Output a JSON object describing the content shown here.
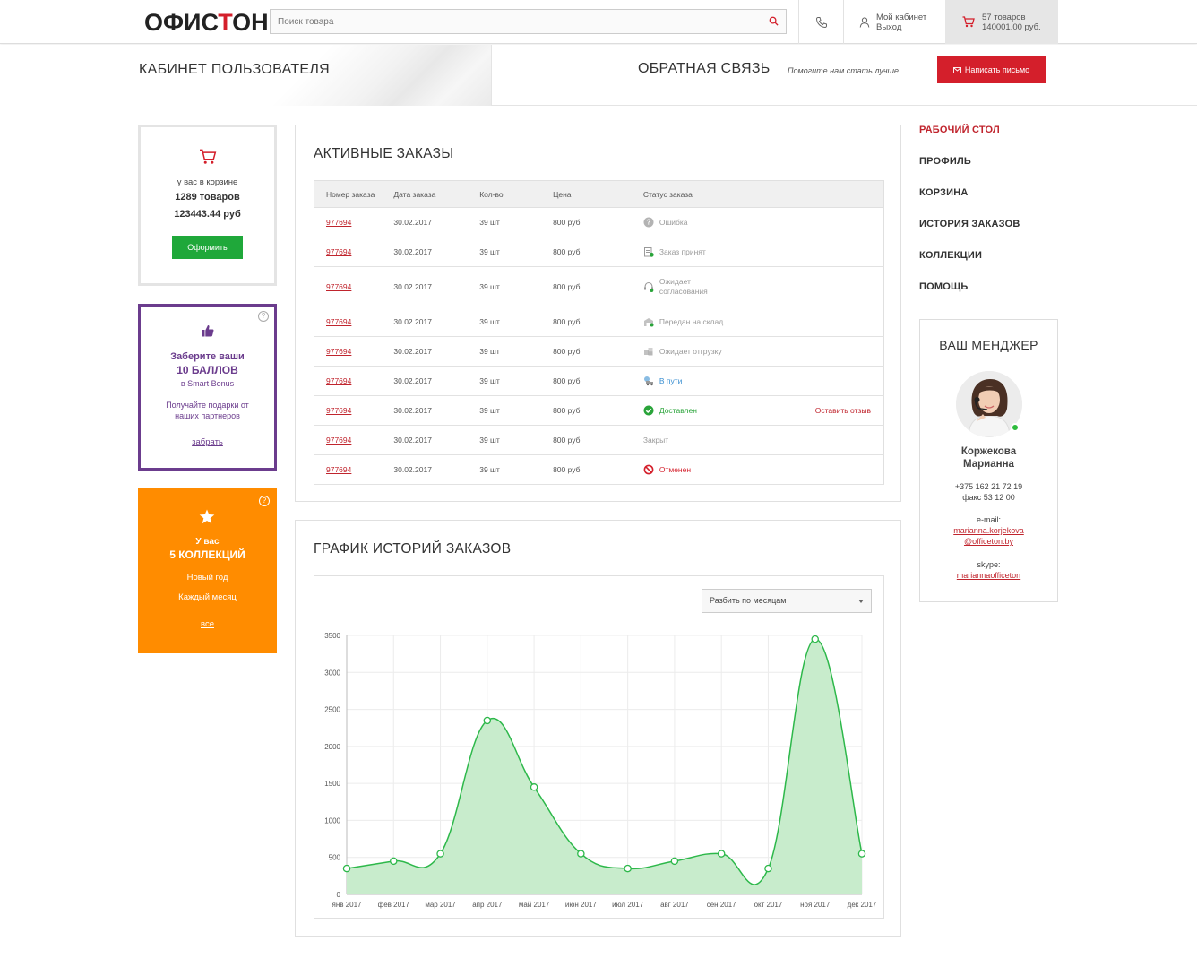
{
  "header": {
    "logo": {
      "part1": "ОФИС",
      "part2": "Т",
      "part3": "ОН"
    },
    "search": {
      "placeholder": "Поиск товара"
    },
    "account": {
      "line1": "Мой кабинет",
      "line2": "Выход"
    },
    "cart": {
      "line1": "57 товаров",
      "line2": "140001.00 руб."
    },
    "icons": {
      "search": "search-icon",
      "phone": "phone-icon",
      "user": "user-icon",
      "cart": "cart-icon"
    }
  },
  "banner": {
    "title": "КАБИНЕТ ПОЛЬЗОВАТЕЛЯ",
    "feedback_title": "ОБРАТНАЯ СВЯЗЬ",
    "feedback_sub": "Помогите нам стать лучше",
    "write_button": "Написать письмо"
  },
  "cart_card": {
    "line1": "у вас в корзине",
    "items": "1289 товаров",
    "sum": "123443.44 руб",
    "button": "Оформить"
  },
  "bonus_card": {
    "line1": "Заберите ваши",
    "line2": "10 БАЛЛОВ",
    "line3": "в Smart Bonus",
    "line4": "Получайте подарки от наших партнеров",
    "link": "забрать",
    "help": "?"
  },
  "collections_card": {
    "line1": "У вас",
    "line2": "5 КОЛЛЕКЦИЙ",
    "item1": "Новый год",
    "item2": "Каждый месяц",
    "link": "все",
    "help": "?"
  },
  "orders": {
    "title": "АКТИВНЫЕ ЗАКАЗЫ",
    "columns": [
      "Номер заказа",
      "Дата заказа",
      "Кол-во",
      "Цена",
      "Статус заказа"
    ],
    "rows": [
      {
        "num": "977694",
        "date": "30.02.2017",
        "qty": "39 шт",
        "price": "800 руб",
        "status": "Ошибка",
        "status2": "",
        "icon": "question-icon",
        "color": "#999999",
        "action": ""
      },
      {
        "num": "977694",
        "date": "30.02.2017",
        "qty": "39 шт",
        "price": "800 руб",
        "status": "Заказ принят",
        "status2": "",
        "icon": "clipboard-icon",
        "color": "#999999",
        "action": ""
      },
      {
        "num": "977694",
        "date": "30.02.2017",
        "qty": "39 шт",
        "price": "800 руб",
        "status": "Ожидает",
        "status2": "согласования",
        "icon": "headset-icon",
        "color": "#999999",
        "action": ""
      },
      {
        "num": "977694",
        "date": "30.02.2017",
        "qty": "39 шт",
        "price": "800 руб",
        "status": "Передан на склад",
        "status2": "",
        "icon": "warehouse-icon",
        "color": "#999999",
        "action": ""
      },
      {
        "num": "977694",
        "date": "30.02.2017",
        "qty": "39 шт",
        "price": "800 руб",
        "status": "Ожидает отгрузку",
        "status2": "",
        "icon": "boxes-icon",
        "color": "#999999",
        "action": ""
      },
      {
        "num": "977694",
        "date": "30.02.2017",
        "qty": "39 шт",
        "price": "800 руб",
        "status": "В пути",
        "status2": "",
        "icon": "truck-icon",
        "color": "#3a8fd1",
        "action": ""
      },
      {
        "num": "977694",
        "date": "30.02.2017",
        "qty": "39 шт",
        "price": "800 руб",
        "status": "Доставлен",
        "status2": "",
        "icon": "check-circle-icon",
        "color": "#2aa43a",
        "action": "Оставить отзыв"
      },
      {
        "num": "977694",
        "date": "30.02.2017",
        "qty": "39 шт",
        "price": "800 руб",
        "status": "Закрыт",
        "status2": "",
        "icon": "",
        "color": "#999999",
        "action": ""
      },
      {
        "num": "977694",
        "date": "30.02.2017",
        "qty": "39 шт",
        "price": "800 руб",
        "status": "Отменен",
        "status2": "",
        "icon": "cancel-icon",
        "color": "#d41f2b",
        "action": ""
      }
    ]
  },
  "chart_panel": {
    "title": "ГРАФИК ИСТОРИЙ ЗАКАЗОВ",
    "select_value": "Разбить по месяцам"
  },
  "chart_data": {
    "type": "area",
    "title": "",
    "xlabel": "",
    "ylabel": "",
    "categories": [
      "янв 2017",
      "фев 2017",
      "мар 2017",
      "апр 2017",
      "май 2017",
      "июн 2017",
      "июл 2017",
      "авг 2017",
      "сен 2017",
      "окт 2017",
      "ноя 2017",
      "дек 2017"
    ],
    "values": [
      350,
      450,
      550,
      2350,
      1450,
      550,
      350,
      450,
      550,
      350,
      3450,
      550
    ],
    "ylim": [
      0,
      3500
    ],
    "yticks": [
      0,
      500,
      1000,
      1500,
      2000,
      2500,
      3000,
      3500
    ],
    "grid": true,
    "smooth": true,
    "line_color": "#2db84a",
    "fill_color": "#c8eccc"
  },
  "right_nav": {
    "items": [
      "РАБОЧИЙ СТОЛ",
      "ПРОФИЛЬ",
      "КОРЗИНА",
      "ИСТОРИЯ ЗАКАЗОВ",
      "КОЛЛЕКЦИИ",
      "ПОМОЩЬ"
    ],
    "active_index": 0
  },
  "manager": {
    "title": "ВАШ МЕНДЖЕР",
    "name1": "Коржекова",
    "name2": "Марианна",
    "phone": "+375 162 21 72 19",
    "fax": "факс 53 12 00",
    "email_label": "e-mail:",
    "email_line1": "marianna.korjekova",
    "email_line2": "@officeton.by",
    "skype_label": "skype:",
    "skype": "mariannaofficeton"
  },
  "colors": {
    "accent": "#d41f2b",
    "green": "#1fa83a",
    "purple": "#6b3c8d",
    "orange": "#ff8c00"
  }
}
